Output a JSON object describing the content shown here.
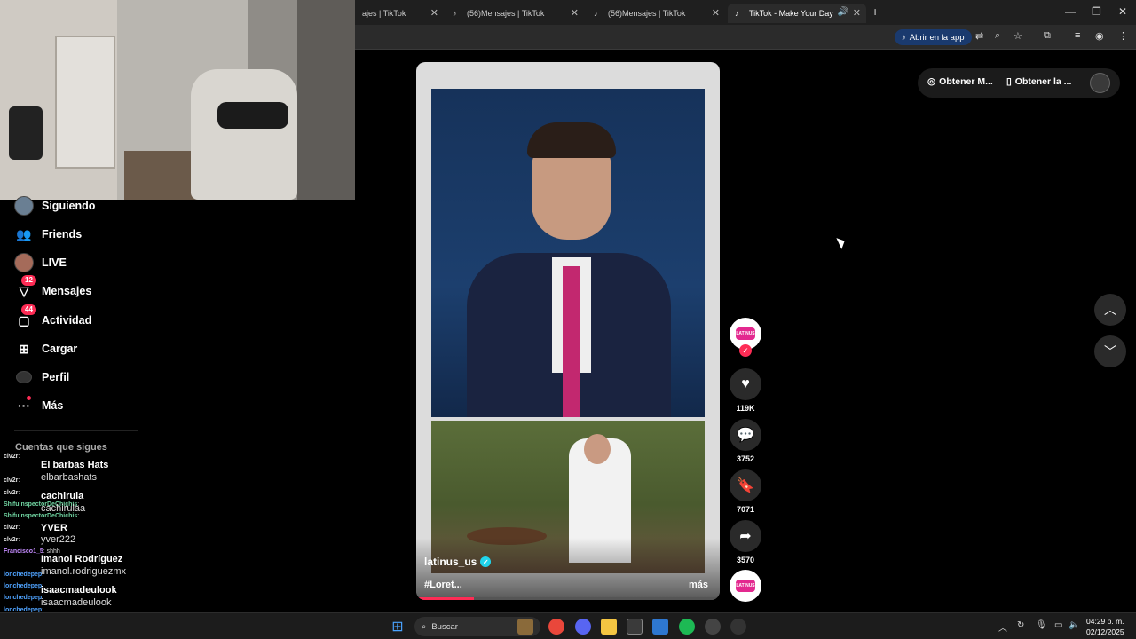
{
  "browser": {
    "tabs": [
      {
        "label": "ajes | TikTok"
      },
      {
        "label": "(56)Mensajes | TikTok"
      },
      {
        "label": "(56)Mensajes | TikTok"
      },
      {
        "label": "TikTok - Make Your Day"
      }
    ],
    "open_app_label": "Abrir en la app"
  },
  "sidebar": {
    "items": [
      {
        "label": "Siguiendo",
        "icon": "following-avatar"
      },
      {
        "label": "Friends",
        "icon": "friends-icon"
      },
      {
        "label": "LIVE",
        "icon": "live-avatar"
      },
      {
        "label": "Mensajes",
        "icon": "messages-icon",
        "badge": "12"
      },
      {
        "label": "Actividad",
        "icon": "activity-icon",
        "badge": "44"
      },
      {
        "label": "Cargar",
        "icon": "upload-icon"
      },
      {
        "label": "Perfil",
        "icon": "profile-icon"
      },
      {
        "label": "Más",
        "icon": "more-icon"
      }
    ],
    "following_title": "Cuentas que sigues",
    "following": [
      {
        "name": "El barbas Hats",
        "handle": "elbarbashats"
      },
      {
        "name": "cachirula",
        "handle": "cachirulaa"
      },
      {
        "name": "YVER",
        "handle": "yver222"
      },
      {
        "name": "Imanol Rodríguez",
        "handle": "imanol.rodriguezmx"
      },
      {
        "name": "isaacmadeulook",
        "handle": "isaacmadeulook"
      }
    ]
  },
  "chat": [
    {
      "user": "clv2r",
      "text": ":"
    },
    {
      "user": "clv2r",
      "text": ":"
    },
    {
      "user": "clv2r",
      "text": ":"
    },
    {
      "user": "ShifuInspectorDeChichis",
      "text": ":"
    },
    {
      "user": "ShifuInspectorDeChichis",
      "text": ":"
    },
    {
      "user": "clv2r",
      "text": ":"
    },
    {
      "user": "clv2r",
      "text": ":"
    },
    {
      "user": "Francisco1_5",
      "text": ": shhh"
    },
    {
      "user": "lonchedepep",
      "text": ":"
    },
    {
      "user": "lonchedepep",
      "text": ":"
    },
    {
      "user": "lonchedepep",
      "text": ":"
    },
    {
      "user": "lonchedepep",
      "text": ":"
    },
    {
      "user": "clv2r",
      "text": ":"
    }
  ],
  "video": {
    "author": "latinus_us",
    "caption": "#Loret...",
    "more_label": "más",
    "progress": 0.19,
    "likes": "119K",
    "comments": "3752",
    "saves": "7071",
    "shares": "3570",
    "logo_text": "LATINUS"
  },
  "top_right": {
    "get_coins": "Obtener M...",
    "get_app": "Obtener la ..."
  },
  "taskbar": {
    "search_placeholder": "Buscar",
    "time": "04:29 p. m.",
    "date": "02/12/2025"
  },
  "colors": {
    "accent": "#fe2c55",
    "verified": "#20d5ec",
    "brand_magenta": "#e3298f"
  }
}
